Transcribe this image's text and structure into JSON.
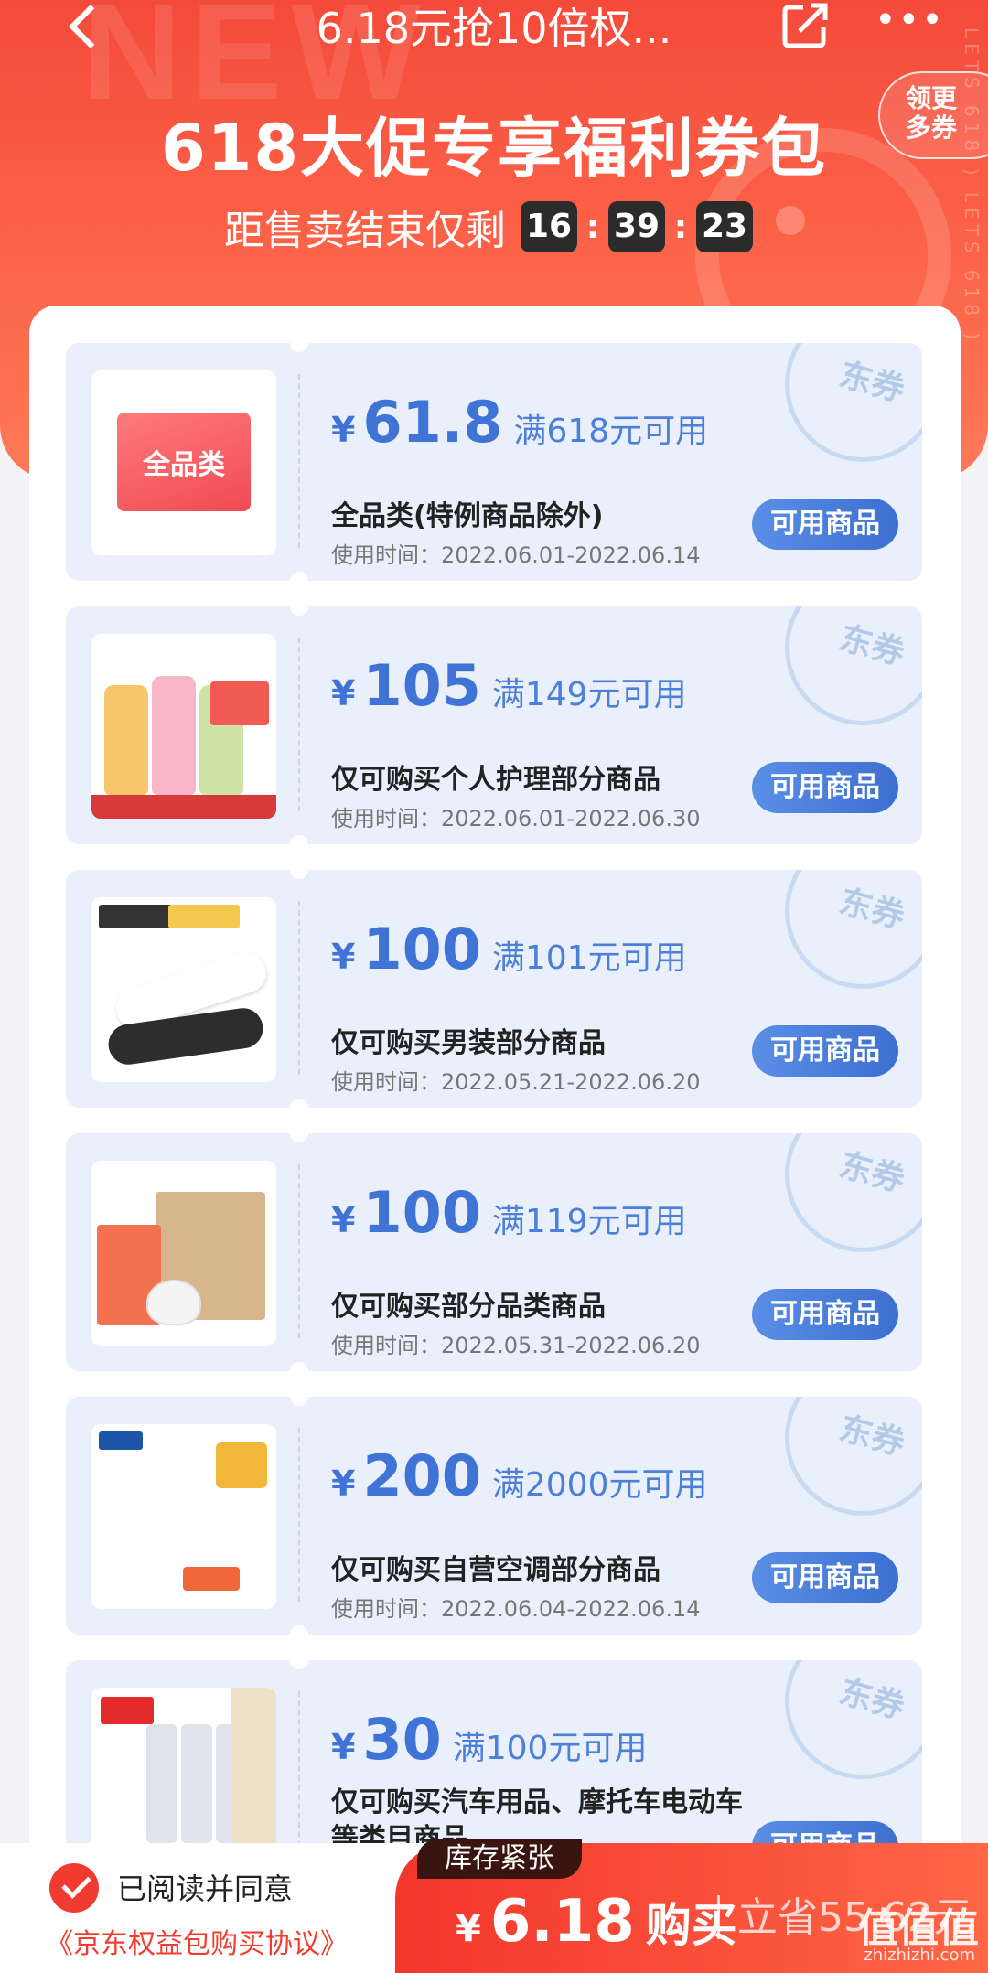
{
  "nav": {
    "title": "6.18元抢10倍权...",
    "more_icon": "more-dots-icon",
    "share_icon": "share-icon",
    "back_icon": "back-arrow-icon"
  },
  "hero": {
    "title": "618大促专享福利券包",
    "countdown_label": "距售卖结束仅剩",
    "hours": "16",
    "minutes": "39",
    "seconds": "23",
    "get_more_line1": "领更",
    "get_more_line2": "多券",
    "bg_word": "NEW",
    "side_text": "LETS 618 ) LETS 618 )"
  },
  "stamp_text": "东券",
  "coupons": [
    {
      "yen": "¥",
      "value": "61.8",
      "condition": "满618元可用",
      "desc": "全品类(特例商品除外)",
      "date": "使用时间：2022.06.01-2022.06.14",
      "button": "可用商品",
      "thumb_label": "全品类"
    },
    {
      "yen": "¥",
      "value": "105",
      "condition": "满149元可用",
      "desc": "仅可购买个人护理部分商品",
      "date": "使用时间：2022.06.01-2022.06.30",
      "button": "可用商品"
    },
    {
      "yen": "¥",
      "value": "100",
      "condition": "满101元可用",
      "desc": "仅可购买男装部分商品",
      "date": "使用时间：2022.05.21-2022.06.20",
      "button": "可用商品"
    },
    {
      "yen": "¥",
      "value": "100",
      "condition": "满119元可用",
      "desc": "仅可购买部分品类商品",
      "date": "使用时间：2022.05.31-2022.06.20",
      "button": "可用商品"
    },
    {
      "yen": "¥",
      "value": "200",
      "condition": "满2000元可用",
      "desc": "仅可购买自营空调部分商品",
      "date": "使用时间：2022.06.04-2022.06.14",
      "button": "可用商品"
    },
    {
      "yen": "¥",
      "value": "30",
      "condition": "满100元可用",
      "desc": "仅可购买汽车用品、摩托车电动车等类目商品",
      "date": "",
      "button": "可用商品"
    }
  ],
  "bottom": {
    "agree_text": "已阅读并同意",
    "agree_link": "《京东权益包购买协议》",
    "stock_tag": "库存紧张",
    "yen": "¥",
    "price": "6.18",
    "buy_label": "购买",
    "save_text": "立省55.62元",
    "watermark": "值值值",
    "watermark_url": "zhizhizhi.com"
  },
  "colors": {
    "brand_red": "#f23b30",
    "coupon_blue": "#3f74d6",
    "coupon_bg": "#e9f0fb"
  }
}
